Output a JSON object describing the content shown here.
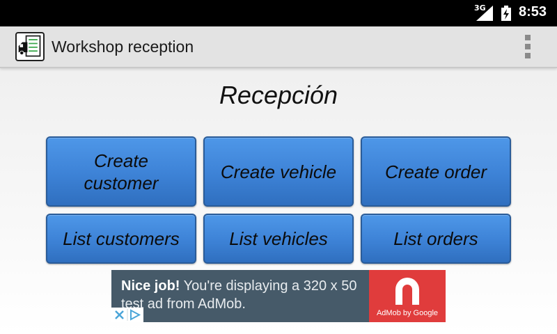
{
  "status_bar": {
    "network": "3G",
    "time": "8:53"
  },
  "action_bar": {
    "title": "Workshop reception",
    "icon": "car-checklist-icon"
  },
  "heading": "Recepción",
  "buttons": [
    {
      "label": "Create customer"
    },
    {
      "label": "Create vehicle"
    },
    {
      "label": "Create order"
    },
    {
      "label": "List customers"
    },
    {
      "label": "List vehicles"
    },
    {
      "label": "List orders"
    }
  ],
  "ad": {
    "headline": "Nice job!",
    "body": " You're displaying a 320 x 50 test ad from AdMob.",
    "brand": "AdMob by Google",
    "colors": {
      "background": "#465a69",
      "logo": "#e03c3c"
    }
  },
  "colors": {
    "button": "#3d82d6",
    "action_bar": "#e3e3e3"
  }
}
